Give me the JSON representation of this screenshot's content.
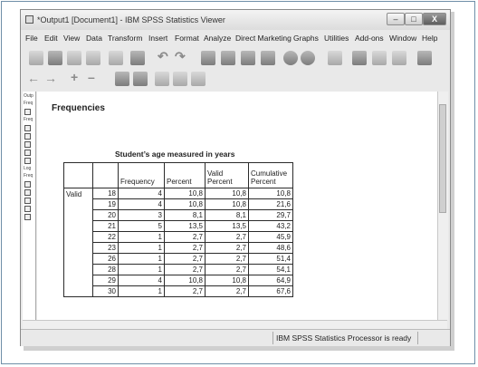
{
  "window": {
    "title": "*Output1 [Document1] - IBM SPSS Statistics Viewer",
    "minimize_label": "–",
    "maximize_label": "□",
    "close_label": "X"
  },
  "menu": [
    "File",
    "Edit",
    "View",
    "Data",
    "Transform",
    "Insert",
    "Format",
    "Analyze",
    "Direct Marketing",
    "Graphs",
    "Utilities",
    "Add-ons",
    "Window",
    "Help"
  ],
  "navigator": {
    "nodes": [
      "Output",
      "Freq",
      "",
      "Freq",
      "",
      "",
      "",
      "Log",
      "Freq",
      "",
      "",
      "",
      ""
    ]
  },
  "output": {
    "heading": "Frequencies",
    "table_title": "Student’s age measured in years",
    "columns": [
      "Frequency",
      "Percent",
      "Valid Percent",
      "Cumulative Percent"
    ],
    "group_label": "Valid",
    "rows": [
      {
        "age": "18",
        "frequency": "4",
        "percent": "10,8",
        "valid_percent": "10,8",
        "cumulative_percent": "10,8"
      },
      {
        "age": "19",
        "frequency": "4",
        "percent": "10,8",
        "valid_percent": "10,8",
        "cumulative_percent": "21,6"
      },
      {
        "age": "20",
        "frequency": "3",
        "percent": "8,1",
        "valid_percent": "8,1",
        "cumulative_percent": "29,7"
      },
      {
        "age": "21",
        "frequency": "5",
        "percent": "13,5",
        "valid_percent": "13,5",
        "cumulative_percent": "43,2"
      },
      {
        "age": "22",
        "frequency": "1",
        "percent": "2,7",
        "valid_percent": "2,7",
        "cumulative_percent": "45,9"
      },
      {
        "age": "23",
        "frequency": "1",
        "percent": "2,7",
        "valid_percent": "2,7",
        "cumulative_percent": "48,6"
      },
      {
        "age": "26",
        "frequency": "1",
        "percent": "2,7",
        "valid_percent": "2,7",
        "cumulative_percent": "51,4"
      },
      {
        "age": "28",
        "frequency": "1",
        "percent": "2,7",
        "valid_percent": "2,7",
        "cumulative_percent": "54,1"
      },
      {
        "age": "29",
        "frequency": "4",
        "percent": "10,8",
        "valid_percent": "10,8",
        "cumulative_percent": "64,9"
      },
      {
        "age": "30",
        "frequency": "1",
        "percent": "2,7",
        "valid_percent": "2,7",
        "cumulative_percent": "67,6"
      }
    ]
  },
  "status": {
    "processor": "IBM SPSS Statistics Processor is ready"
  },
  "toolbar_icons": [
    "open-icon",
    "save-icon",
    "print-icon",
    "print-preview-icon",
    "export-icon",
    "recall-dialog-icon",
    "undo-icon",
    "redo-icon",
    "goto-data-icon",
    "goto-case-icon",
    "goto-variable-icon",
    "variables-icon",
    "chart-icon",
    "designate-window-icon",
    "select-cases-icon",
    "value-labels-icon",
    "use-sets-icon",
    "insert-output-icon",
    "insert-heading-icon"
  ],
  "colors": {
    "window_chrome": "#e9e9e9",
    "close_button": "#5e5e5e",
    "outer_frame": "#6f8fa8"
  }
}
